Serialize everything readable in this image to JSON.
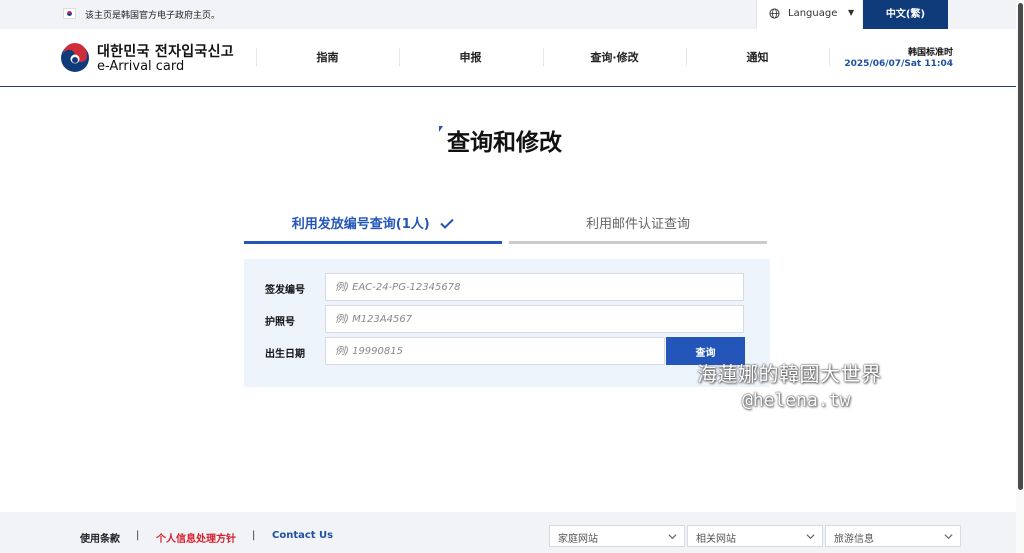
{
  "topbar": {
    "notice": "该主页是韩国官方电子政府主页。",
    "language_label": "Language",
    "current_language": "中文(繁)"
  },
  "header": {
    "logo_ko": "대한민국 전자입국신고",
    "logo_en": "e-Arrival card",
    "nav": [
      "指南",
      "申报",
      "查询·修改",
      "通知"
    ],
    "time_label": "韩国标准时",
    "time_value": "2025/06/07/Sat 11:04"
  },
  "main": {
    "title": "查询和修改",
    "tabs": [
      {
        "label": "利用发放编号查询(1人)",
        "active": true
      },
      {
        "label": "利用邮件认证查询",
        "active": false
      }
    ],
    "form": {
      "issue_number": {
        "label": "签发编号",
        "placeholder": "例) EAC-24-PG-12345678"
      },
      "passport": {
        "label": "护照号",
        "placeholder": "例) M123A4567"
      },
      "birth_date": {
        "label": "出生日期",
        "placeholder": "例) 19990815"
      },
      "search_label": "查询"
    }
  },
  "watermark": {
    "line1": "海蓮娜的韓國大世界",
    "line2": "@helena.tw"
  },
  "footer": {
    "terms": "使用条款",
    "privacy": "个人信息处理方针",
    "contact": "Contact Us",
    "separator": "|",
    "selects": [
      "家庭网站",
      "相关网站",
      "旅游信息"
    ]
  },
  "colors": {
    "primary": "#2456b9",
    "navy": "#0f3b7b",
    "privacy_red": "#d4202e",
    "panel": "#eef4fc"
  }
}
